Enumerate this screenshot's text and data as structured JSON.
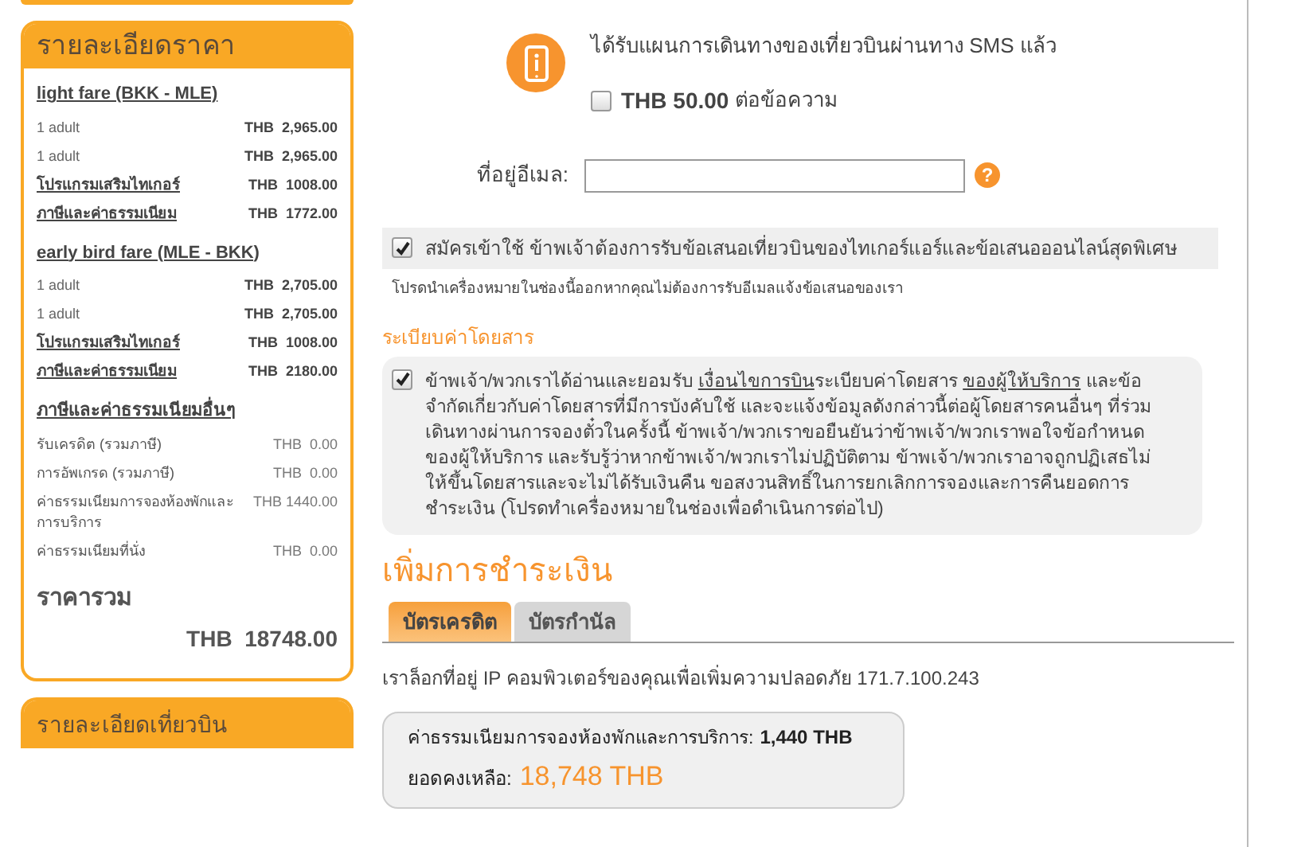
{
  "price_panel": {
    "title": "รายละเอียดราคา",
    "groups": [
      {
        "title": "light fare (BKK - MLE)",
        "rows": [
          {
            "kind": "plain",
            "label": "1 adult",
            "amount": "THB  2,965.00"
          },
          {
            "kind": "plain",
            "label": "1 adult",
            "amount": "THB  2,965.00"
          },
          {
            "kind": "link",
            "label": "โปรแกรมเสริมไทเกอร์",
            "amount": "THB  1008.00"
          },
          {
            "kind": "link",
            "label": "ภาษีและค่าธรรมเนียม",
            "amount": "THB  1772.00"
          }
        ]
      },
      {
        "title": "early bird fare (MLE - BKK)",
        "rows": [
          {
            "kind": "plain",
            "label": "1 adult",
            "amount": "THB  2,705.00"
          },
          {
            "kind": "plain",
            "label": "1 adult",
            "amount": "THB  2,705.00"
          },
          {
            "kind": "link",
            "label": "โปรแกรมเสริมไทเกอร์",
            "amount": "THB  1008.00"
          },
          {
            "kind": "link",
            "label": "ภาษีและค่าธรรมเนียม",
            "amount": "THB  2180.00"
          }
        ]
      },
      {
        "title": "ภาษีและค่าธรรมเนียมอื่นๆ",
        "rows": [
          {
            "kind": "fee",
            "label": "รับเครดิต (รวมภาษี)",
            "amount": "THB  0.00"
          },
          {
            "kind": "fee",
            "label": "การอัพเกรด (รวมภาษี)",
            "amount": "THB  0.00"
          },
          {
            "kind": "fee",
            "label": "ค่าธรรมเนียมการจองห้องพักและการบริการ",
            "amount": "THB 1440.00"
          },
          {
            "kind": "fee",
            "label": "ค่าธรรมเนียมที่นั่ง",
            "amount": "THB  0.00"
          }
        ]
      }
    ],
    "total_label": "ราคารวม",
    "total_amount": "THB  18748.00"
  },
  "flight_panel": {
    "title": "รายละเอียดเที่ยวบิน"
  },
  "sms": {
    "text": "ได้รับแผนการเดินทางของเที่ยวบินผ่านทาง SMS แล้ว",
    "checked": false,
    "price": "THB 50.00",
    "price_suffix": "ต่อข้อความ"
  },
  "email": {
    "label": "ที่อยู่อีเมล:",
    "help": "?"
  },
  "subscribe": {
    "checked": true,
    "text": "สมัครเข้าใช้ ข้าพเจ้าต้องการรับข้อเสนอเที่ยวบินของไทเกอร์แอร์และข้อเสนอออนไลน์สุดพิเศษ",
    "note": "โปรดนำเครื่องหมายในช่องนี้ออกหากคุณไม่ต้องการรับอีเมลแจ้งข้อเสนอของเรา"
  },
  "fare_rules": {
    "heading": "ระเบียบค่าโดยสาร",
    "checked": true,
    "parts": [
      {
        "kind": "text",
        "text": "ข้าพเจ้า/พวกเราได้อ่านและยอมรับ "
      },
      {
        "kind": "link",
        "text": "เงื่อนไขการบิน"
      },
      {
        "kind": "text",
        "text": "ระเบียบค่าโดยสาร "
      },
      {
        "kind": "link",
        "text": "ของผู้ให้บริการ"
      },
      {
        "kind": "text",
        "text": " และข้อจำกัดเกี่ยวกับค่าโดยสารที่มีการบังคับใช้ และจะแจ้งข้อมูลดังกล่าวนี้ต่อผู้โดยสารคนอื่นๆ ที่ร่วมเดินทางผ่านการจองตั๋วในครั้งนี้ ข้าพเจ้า/พวกเราขอยืนยันว่าข้าพเจ้า/พวกเราพอใจข้อกำหนดของผู้ให้บริการ และรับรู้ว่าหากข้าพเจ้า/พวกเราไม่ปฏิบัติตาม ข้าพเจ้า/พวกเราอาจถูกปฏิเสธไม่ให้ขึ้นโดยสารและจะไม่ได้รับเงินคืน ขอสงวนสิทธิ์ในการยกเลิกการจองและการคืนยอดการชำระเงิน (โปรดทำเครื่องหมายในช่องเพื่อดำเนินการต่อไป)"
      }
    ]
  },
  "payment": {
    "heading": "เพิ่มการชำระเงิน",
    "tabs": [
      {
        "label": "บัตรเครดิต",
        "selected": true
      },
      {
        "label": "บัตรกำนัล",
        "selected": false
      }
    ],
    "ip_text": "เราล็อกที่อยู่ IP คอมพิวเตอร์ของคุณเพื่อเพิ่มความปลอดภัย  171.7.100.243",
    "fee_label": "ค่าธรรมเนียมการจองห้องพักและการบริการ:",
    "fee_value": "1,440 THB",
    "balance_label": "ยอดคงเหลือ:",
    "balance_value": "18,748 THB"
  }
}
